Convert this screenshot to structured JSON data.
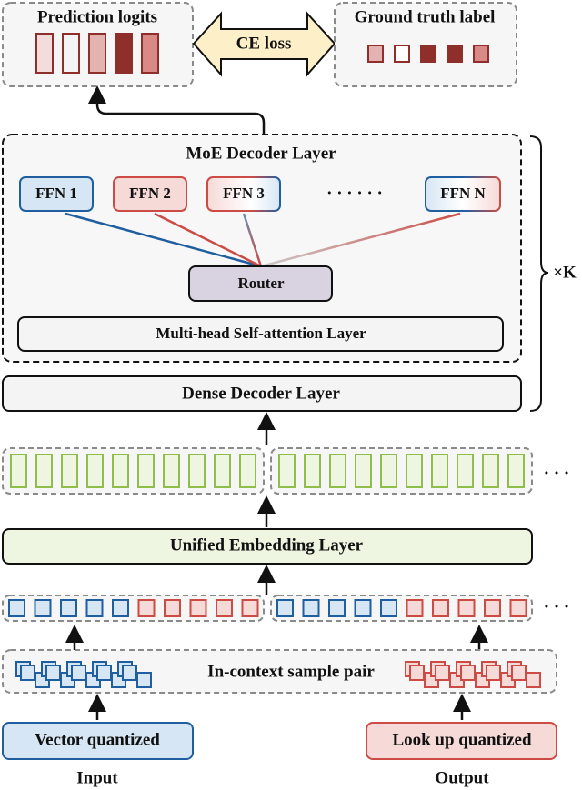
{
  "top": {
    "prediction_title": "Prediction logits",
    "ground_truth_title": "Ground truth label",
    "loss_label": "CE loss",
    "logit_colors": [
      "#f3dcdc",
      "#f4f4f4",
      "#e3b3b1",
      "#8e2f2c",
      "#d98a87"
    ],
    "label_colors": [
      "#e3b3b1",
      "#ffffff",
      "#8e2f2c",
      "#8e2f2c",
      "#d98a87"
    ]
  },
  "moe": {
    "title": "MoE Decoder Layer",
    "ffns": [
      "FFN 1",
      "FFN 2",
      "FFN 3",
      "FFN N"
    ],
    "dots": "· · · · · ·",
    "router": "Router",
    "attention": "Multi-head Self-attention Layer"
  },
  "dense": "Dense Decoder Layer",
  "repeat": "×K",
  "embedding": "Unified Embedding Layer",
  "context": "In-context sample pair",
  "ellipsis": "· · ·",
  "inputs": {
    "left_box": "Vector quantized",
    "right_box": "Look up quantized",
    "left_label": "Input",
    "right_label": "Output"
  },
  "colors": {
    "blue": "#1f5fa0",
    "blue_fill": "#d7e6f4",
    "red": "#cc4b45",
    "red_fill": "#f6dad8",
    "green": "#8fbf4a",
    "green_fill": "#eef5e0",
    "dark_red": "#8e2f2c",
    "loss_fill": "#fdf0c8",
    "router_fill": "#d9d2e1"
  }
}
